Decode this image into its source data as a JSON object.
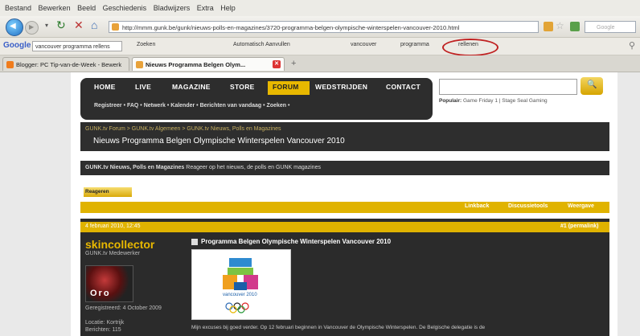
{
  "browser": {
    "menu": [
      "Bestand",
      "Bewerken",
      "Beeld",
      "Geschiedenis",
      "Bladwijzers",
      "Extra",
      "Help"
    ],
    "url": "http://mmm.gunk.be/gunk/nieuws-polls-en-magazines/3720-programma-belgen-olympische-winterspelen-vancouver-2010.html",
    "search_placeholder": "Google",
    "toolbar": {
      "logo": "Google",
      "query": "vancouver programma rellens",
      "items": [
        "Zoeken",
        "Automatisch Aanvullen",
        "vancouver",
        "programma",
        "rellenen"
      ],
      "highlighted_item": "rellenen"
    },
    "tabs": [
      {
        "label": "Blogger: PC Tip-van-de-Week - Bewerk",
        "active": false
      },
      {
        "label": "Nieuws Programma Belgen Olym...",
        "active": true
      }
    ]
  },
  "site": {
    "nav": [
      "HOME",
      "LIVE",
      "MAGAZINE",
      "STORE",
      "FORUM",
      "WEDSTRIJDEN",
      "CONTACT"
    ],
    "active_nav": "FORUM",
    "subnav": "Registreer  •  FAQ  •  Netwerk  •  Kalender  •  Berichten van vandaag  •  Zoeken  •",
    "popular_label": "Populair:",
    "popular_text": "Game Friday 1 | Stage Seal Gaming",
    "breadcrumb": "GUNK.tv Forum  >  GUNK.tv Algemeen  >  GUNK.tv Nieuws, Polls en Magazines",
    "thread_title": "Nieuws Programma Belgen Olympische Winterspelen Vancouver 2010",
    "info_title": "GUNK.tv Nieuws, Polls en Magazines",
    "info_desc": "Reageer op het nieuws, de polls en GUNK magazines",
    "reply_button": "Reageren",
    "thread_tools": [
      "Linkback",
      "Discussietools",
      "Weergave"
    ]
  },
  "post": {
    "date": "4 februari 2010, 12:45",
    "number": "#1 (permalink)",
    "username": "skincollector",
    "user_title": "GUNK.tv Medewerker",
    "avatar_text": "Oro",
    "registered": "Geregistreerd: 4 October 2009",
    "location": "Locatie: Kortrijk",
    "posts": "Berichten: 115",
    "title": "Programma Belgen Olympische Winterspelen Vancouver 2010",
    "logo_caption": "vancouver 2010",
    "body": "Mijn excuses bij goed verder. Op 12 februari beginnen in Vancouver de Olympische Winterspelen. De Belgische delegatie is de"
  },
  "colors": {
    "accent": "#e0b300",
    "dark": "#2d2d2d",
    "oval": "#c02222"
  }
}
